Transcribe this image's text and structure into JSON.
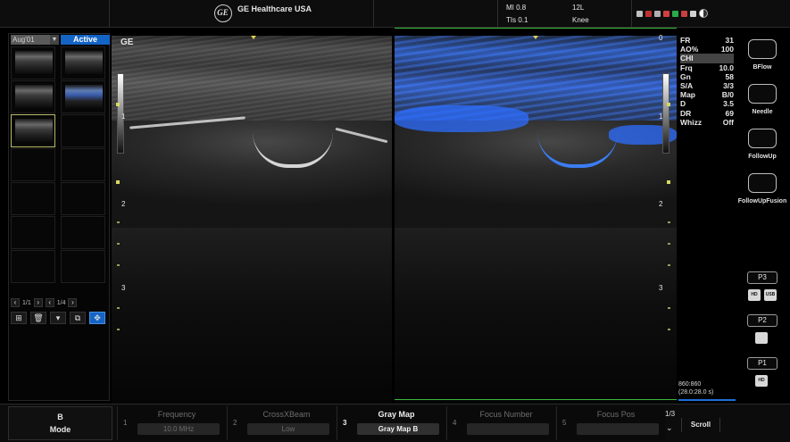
{
  "header": {
    "logo_text": "GE",
    "title": "GE Healthcare USA",
    "mi": "MI 0.8",
    "tis": "TIs 0.1",
    "probe": "12L",
    "preset": "Knee"
  },
  "thumbnails": {
    "date_selector": "Aug'01",
    "active_label": "Active",
    "pager_left": "1/1",
    "pager_right": "1/4"
  },
  "image": {
    "overlay_label": "GE",
    "depth_labels": [
      "1",
      "2",
      "3"
    ],
    "top_zero": "0"
  },
  "parameters": [
    {
      "key": "FR",
      "value": "31"
    },
    {
      "key": "AO%",
      "value": "100"
    },
    {
      "key": "CHI",
      "value": ""
    },
    {
      "key": "Frq",
      "value": "10.0"
    },
    {
      "key": "Gn",
      "value": "58"
    },
    {
      "key": "S/A",
      "value": "3/3"
    },
    {
      "key": "Map",
      "value": "B/0"
    },
    {
      "key": "D",
      "value": "3.5"
    },
    {
      "key": "DR",
      "value": "69"
    },
    {
      "key": "Whizz",
      "value": "Off"
    }
  ],
  "cine": {
    "frames": "860:860",
    "time": "(28.0:28.0 s)"
  },
  "side_buttons": {
    "bflow": "BFlow",
    "needle": "Needle",
    "followup": "FollowUp",
    "followup_fusion": "FollowUpFusion",
    "p3": "P3",
    "p2": "P2",
    "p1": "P1",
    "hd": "HD",
    "usb": "USB"
  },
  "bottom": {
    "mode_line1": "B",
    "mode_line2": "Mode",
    "knobs": [
      {
        "num": "1",
        "title": "Frequency",
        "value": "10.0 MHz"
      },
      {
        "num": "2",
        "title": "CrossXBeam",
        "value": "Low"
      },
      {
        "num": "3",
        "title": "Gray Map",
        "value": "Gray Map B"
      },
      {
        "num": "4",
        "title": "Focus Number",
        "value": ""
      },
      {
        "num": "5",
        "title": "Focus Pos",
        "value": ""
      }
    ],
    "page": "1/3",
    "scroll": "Scroll"
  },
  "colors": {
    "accent_blue": "#1464c6",
    "doppler_blue": "#3b7df2",
    "green_marker": "#3cb83c"
  }
}
